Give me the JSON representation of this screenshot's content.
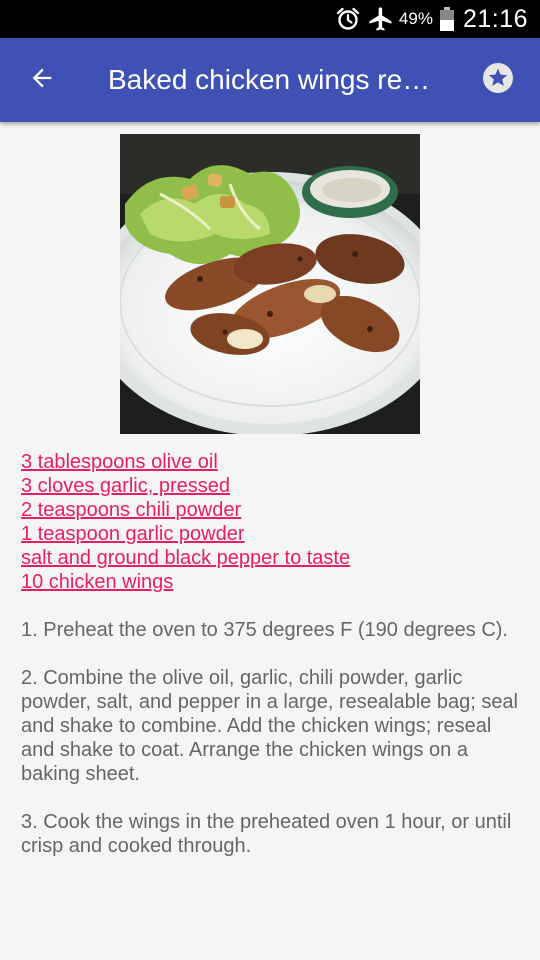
{
  "status_bar": {
    "battery_percent": "49%",
    "time": "21:16",
    "icons": [
      "alarm-icon",
      "airplane-mode-icon",
      "battery-icon"
    ]
  },
  "app_bar": {
    "title": "Baked chicken wings re…",
    "back_icon": "arrow-back-icon",
    "favorite_icon": "star-icon",
    "color": "#3f51b5"
  },
  "recipe": {
    "ingredients": [
      "3 tablespoons olive oil",
      "3 cloves garlic, pressed",
      "2 teaspoons chili powder",
      "1 teaspoon garlic powder",
      "salt and ground black pepper to taste",
      "10 chicken wings"
    ],
    "ingredient_color": "#e91e63",
    "steps": [
      "1. Preheat the oven to 375 degrees F (190 degrees C).",
      "2. Combine the olive oil, garlic, chili powder, garlic powder, salt, and pepper in a large, resealable bag; seal and shake to combine. Add the chicken wings; reseal and shake to coat. Arrange the chicken wings on a baking sheet.",
      "3. Cook the wings in the preheated oven 1 hour, or until crisp and cooked through."
    ]
  }
}
